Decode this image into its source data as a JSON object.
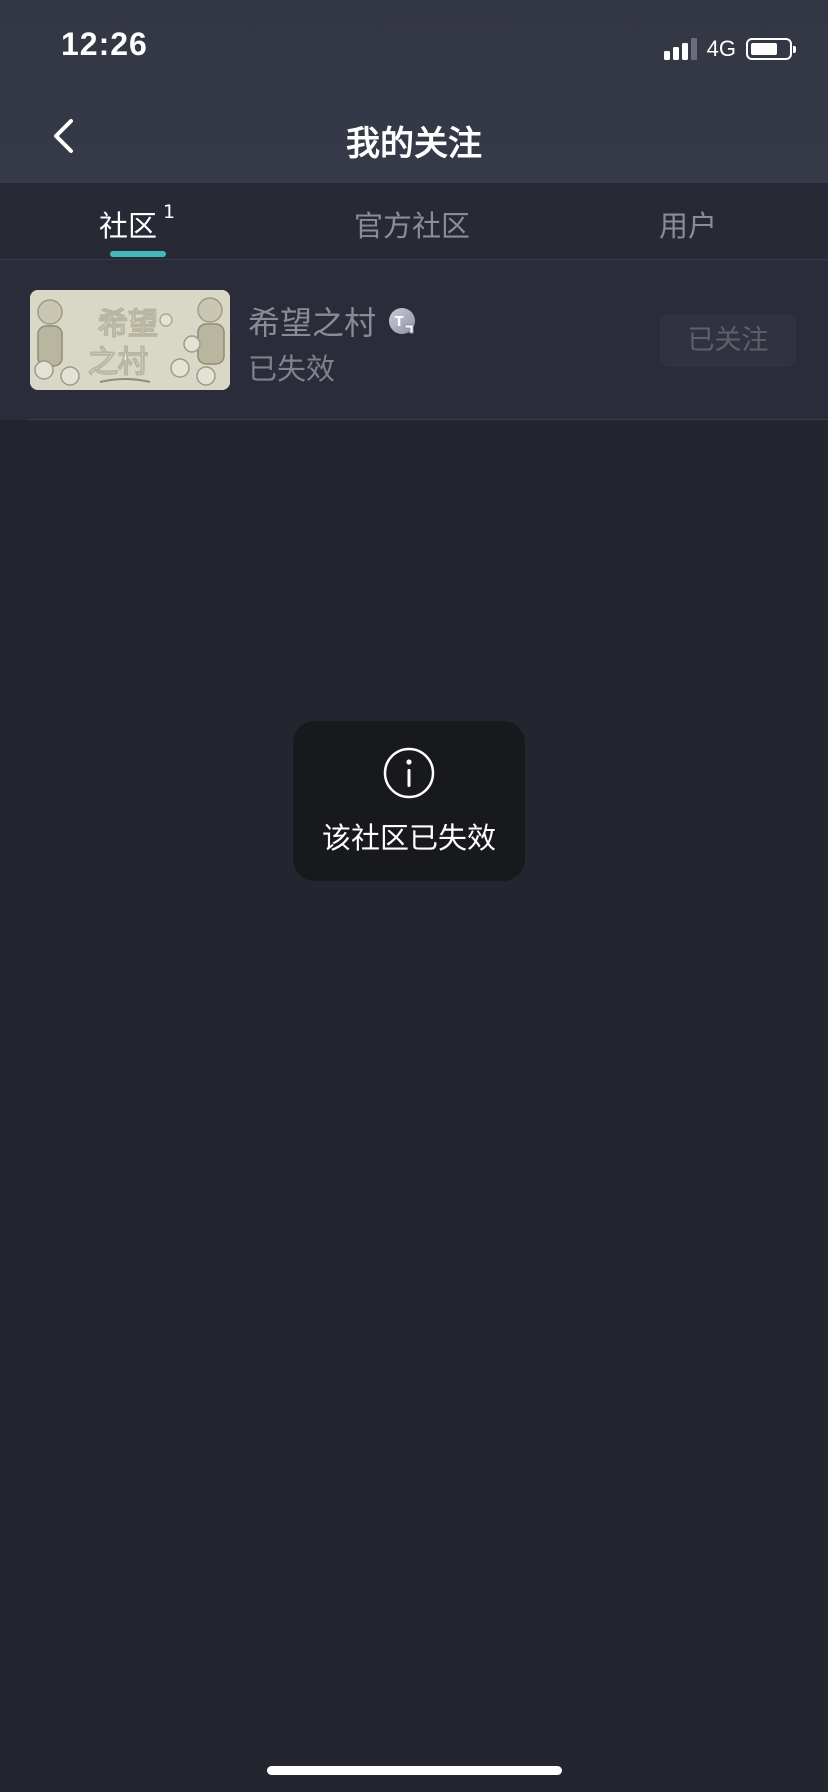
{
  "status_bar": {
    "time": "12:26",
    "network": "4G",
    "signal_bars": 3,
    "signal_bars_total": 4,
    "battery_level": 0.65
  },
  "nav": {
    "title": "我的关注",
    "back_icon": "chevron-left-icon"
  },
  "tabs": [
    {
      "label": "社区",
      "badge": "1",
      "active": true
    },
    {
      "label": "官方社区",
      "badge": "",
      "active": false
    },
    {
      "label": "用户",
      "badge": "",
      "active": false
    }
  ],
  "accent_color": "#47b6bf",
  "communities": [
    {
      "name": "希望之村",
      "status": "已失效",
      "tag_icon": "community-tag-icon",
      "follow_label": "已关注",
      "thumbnail_text": "希望之村"
    }
  ],
  "toast": {
    "icon": "info-icon",
    "message": "该社区已失效"
  }
}
